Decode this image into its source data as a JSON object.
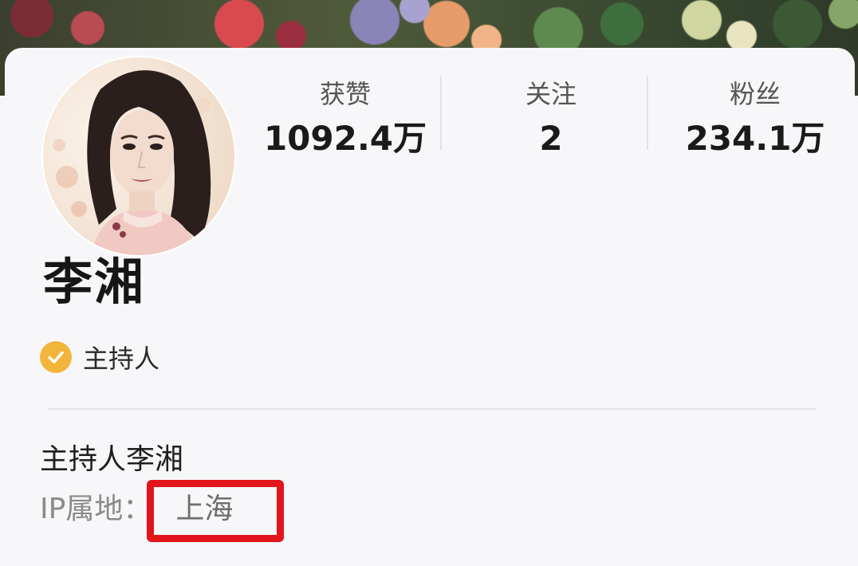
{
  "profile": {
    "name": "李湘",
    "verification": "主持人",
    "bio": "主持人李湘",
    "ip_label": "IP属地：",
    "ip_location": "上海"
  },
  "stats": {
    "likes": {
      "label": "获赞",
      "value": "1092.4万"
    },
    "following": {
      "label": "关注",
      "value": "2"
    },
    "fans": {
      "label": "粉丝",
      "value": "234.1万"
    }
  },
  "icons": {
    "verified": "check-circle-icon",
    "avatar": "avatar"
  },
  "colors": {
    "verified_badge": "#f2b53c",
    "highlight_box": "#e3151c",
    "card_background": "#f7f7f9"
  }
}
